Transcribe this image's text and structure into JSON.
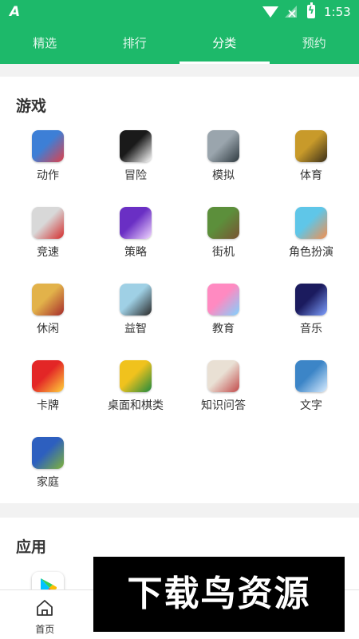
{
  "status_bar": {
    "app_glyph": "A",
    "time": "1:53"
  },
  "top_tabs": [
    {
      "label": "精选"
    },
    {
      "label": "排行"
    },
    {
      "label": "分类",
      "active": true
    },
    {
      "label": "预约"
    }
  ],
  "games": {
    "title": "游戏",
    "categories": [
      {
        "label": "动作",
        "icon": "action-icon",
        "colors": [
          "#3d7fd6",
          "#e0404a"
        ]
      },
      {
        "label": "冒险",
        "icon": "adventure-icon",
        "colors": [
          "#1a1a1a",
          "#ffffff"
        ]
      },
      {
        "label": "模拟",
        "icon": "simulation-icon",
        "colors": [
          "#9aa5ad",
          "#2f3a40"
        ]
      },
      {
        "label": "体育",
        "icon": "sports-icon",
        "colors": [
          "#c89a2a",
          "#3a2f1a"
        ]
      },
      {
        "label": "竞速",
        "icon": "racing-icon",
        "colors": [
          "#d8d8d8",
          "#d42c2c"
        ]
      },
      {
        "label": "策略",
        "icon": "strategy-icon",
        "colors": [
          "#6a2fc4",
          "#f1d6ff"
        ]
      },
      {
        "label": "街机",
        "icon": "arcade-icon",
        "colors": [
          "#5c8f3b",
          "#7a5333"
        ]
      },
      {
        "label": "角色扮演",
        "icon": "role-playing-icon",
        "colors": [
          "#5fc6e8",
          "#f38f4e"
        ]
      },
      {
        "label": "休闲",
        "icon": "casual-icon",
        "colors": [
          "#e2b24a",
          "#a62b2b"
        ]
      },
      {
        "label": "益智",
        "icon": "puzzle-icon",
        "colors": [
          "#9fd0e5",
          "#2a2a2a"
        ]
      },
      {
        "label": "教育",
        "icon": "education-icon",
        "colors": [
          "#ff8ac1",
          "#7fd2ff"
        ]
      },
      {
        "label": "音乐",
        "icon": "music-icon",
        "colors": [
          "#1b1b5e",
          "#7fa0ff"
        ]
      },
      {
        "label": "卡牌",
        "icon": "card-icon",
        "colors": [
          "#e32626",
          "#ffd23a"
        ]
      },
      {
        "label": "桌面和棋类",
        "icon": "board-game-icon",
        "colors": [
          "#f0c21d",
          "#1f8a3f"
        ]
      },
      {
        "label": "知识问答",
        "icon": "trivia-icon",
        "colors": [
          "#e9e0d4",
          "#c24a4a"
        ]
      },
      {
        "label": "文字",
        "icon": "word-icon",
        "colors": [
          "#3c85c7",
          "#d8ecff"
        ]
      },
      {
        "label": "家庭",
        "icon": "family-icon",
        "colors": [
          "#2d5fbf",
          "#7fb33a"
        ]
      }
    ]
  },
  "apps": {
    "title": "应用",
    "first_icon": "google-play-icon"
  },
  "bottom_nav": [
    {
      "label": "首页",
      "icon": "home-icon"
    },
    {
      "label": "",
      "icon": "category-icon",
      "selected": true
    },
    {
      "label": "",
      "icon": "news-icon"
    },
    {
      "label": "",
      "icon": "profile-icon"
    }
  ],
  "watermark": "下载鸟资源",
  "colors": {
    "brand_green": "#1db96a",
    "text": "#333333",
    "divider": "#f2f2f2"
  }
}
